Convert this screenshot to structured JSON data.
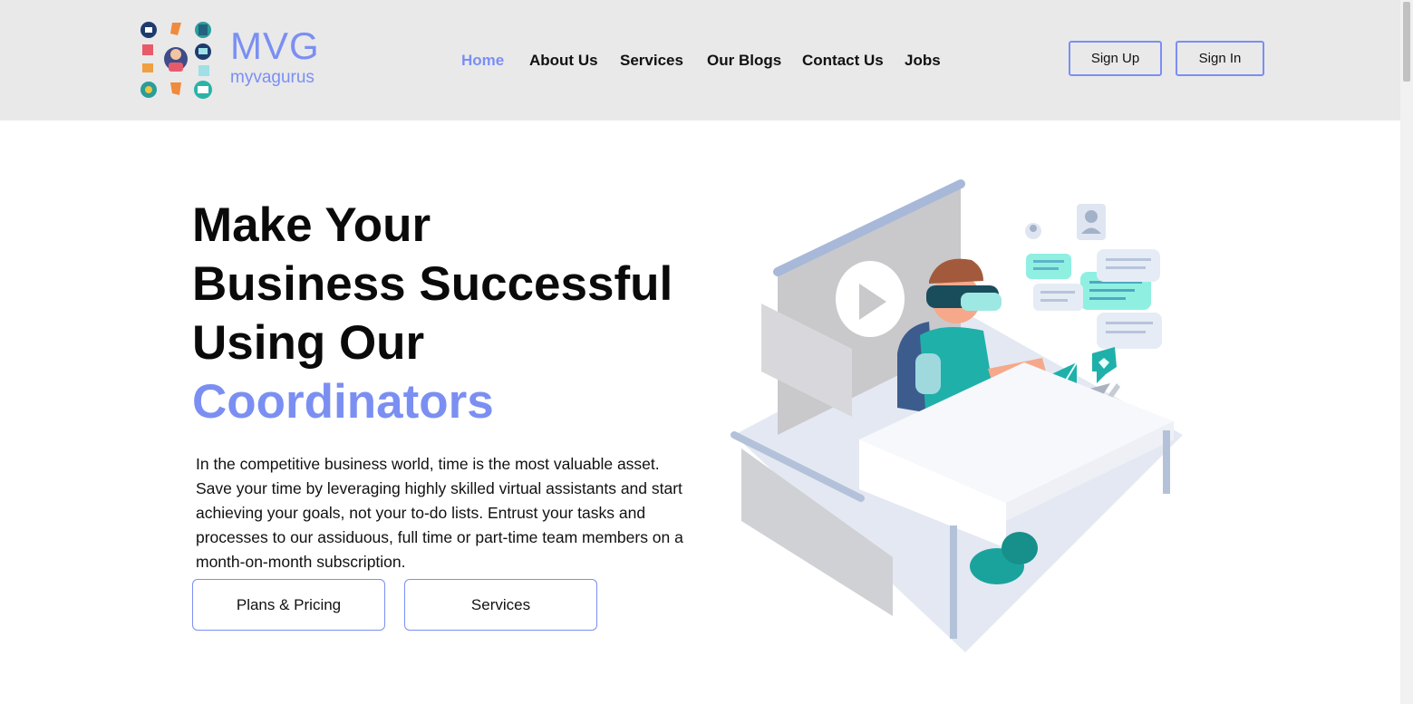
{
  "brand": {
    "name": "MVG",
    "tagline": "myvagurus",
    "accent_color": "#7b8ff2",
    "header_bg": "#e9e9ea"
  },
  "nav": {
    "items": [
      {
        "label": "Home",
        "active": true
      },
      {
        "label": "About Us",
        "active": false
      },
      {
        "label": "Services",
        "active": false
      },
      {
        "label": "Our Blogs",
        "active": false
      },
      {
        "label": "Contact Us",
        "active": false
      },
      {
        "label": "Jobs",
        "active": false
      }
    ]
  },
  "auth": {
    "signup_label": "Sign Up",
    "signin_label": "Sign In"
  },
  "hero": {
    "title_lines": [
      "Make Your",
      "Business Successful",
      "Using Our"
    ],
    "title_accent": "Coordinators",
    "description": "In the competitive business world, time is the most valuable asset. Save your time by leveraging highly skilled virtual assistants and start achieving your goals, not your to-do lists. Entrust your tasks and processes to our assiduous, full time or part-time team members on a month-on-month subscription.",
    "buttons": {
      "plans_label": "Plans & Pricing",
      "services_label": "Services"
    },
    "illustration": "virtual-assistant-at-desk-illustration"
  }
}
